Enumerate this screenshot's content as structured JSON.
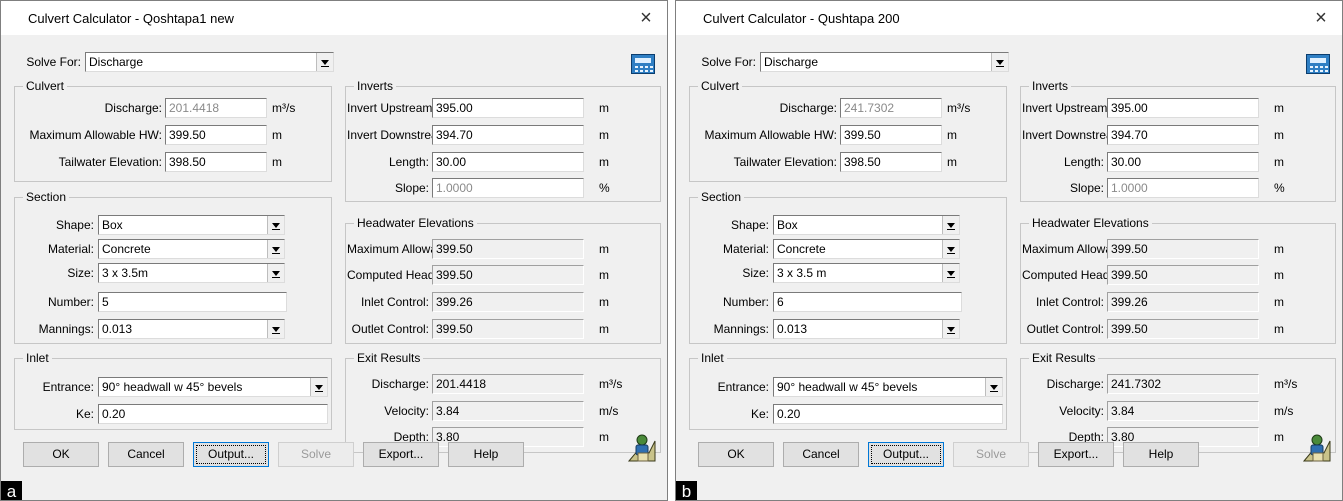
{
  "a": {
    "title": "Culvert Calculator - Qoshtapa1 new",
    "close": "×",
    "solve_for_label": "Solve For:",
    "solve_for_value": "Discharge",
    "culvert": {
      "title": "Culvert",
      "discharge_label": "Discharge:",
      "discharge_value": "201.4418",
      "discharge_unit": "m³/s",
      "max_hw_label": "Maximum Allowable HW:",
      "max_hw_value": "399.50",
      "max_hw_unit": "m",
      "tailwater_label": "Tailwater Elevation:",
      "tailwater_value": "398.50",
      "tailwater_unit": "m"
    },
    "section": {
      "title": "Section",
      "shape_label": "Shape:",
      "shape_value": "Box",
      "material_label": "Material:",
      "material_value": "Concrete",
      "size_label": "Size:",
      "size_value": "3 x 3.5m",
      "number_label": "Number:",
      "number_value": "5",
      "mannings_label": "Mannings:",
      "mannings_value": "0.013"
    },
    "inlet": {
      "title": "Inlet",
      "entrance_label": "Entrance:",
      "entrance_value": "90° headwall w 45° bevels",
      "ke_label": "Ke:",
      "ke_value": "0.20"
    },
    "inverts": {
      "title": "Inverts",
      "upstream_label": "Invert Upstream:",
      "upstream_value": "395.00",
      "upstream_unit": "m",
      "downstream_label": "Invert Downstream:",
      "downstream_value": "394.70",
      "downstream_unit": "m",
      "length_label": "Length:",
      "length_value": "30.00",
      "length_unit": "m",
      "slope_label": "Slope:",
      "slope_value": "1.0000",
      "slope_unit": "%"
    },
    "headwater": {
      "title": "Headwater Elevations",
      "max_label": "Maximum Allowable:",
      "max_value": "399.50",
      "max_unit": "m",
      "computed_label": "Computed Headwater:",
      "computed_value": "399.50",
      "computed_unit": "m",
      "inlet_label": "Inlet Control:",
      "inlet_value": "399.26",
      "inlet_unit": "m",
      "outlet_label": "Outlet Control:",
      "outlet_value": "399.50",
      "outlet_unit": "m"
    },
    "exit": {
      "title": "Exit Results",
      "discharge_label": "Discharge:",
      "discharge_value": "201.4418",
      "discharge_unit": "m³/s",
      "velocity_label": "Velocity:",
      "velocity_value": "3.84",
      "velocity_unit": "m/s",
      "depth_label": "Depth:",
      "depth_value": "3.80",
      "depth_unit": "m"
    },
    "buttons": {
      "ok": "OK",
      "cancel": "Cancel",
      "output": "Output...",
      "solve": "Solve",
      "export": "Export...",
      "help": "Help"
    },
    "corner_label": "a"
  },
  "b": {
    "title": "Culvert Calculator - Qushtapa 200",
    "close": "×",
    "solve_for_label": "Solve For:",
    "solve_for_value": "Discharge",
    "culvert": {
      "title": "Culvert",
      "discharge_label": "Discharge:",
      "discharge_value": "241.7302",
      "discharge_unit": "m³/s",
      "max_hw_label": "Maximum Allowable HW:",
      "max_hw_value": "399.50",
      "max_hw_unit": "m",
      "tailwater_label": "Tailwater Elevation:",
      "tailwater_value": "398.50",
      "tailwater_unit": "m"
    },
    "section": {
      "title": "Section",
      "shape_label": "Shape:",
      "shape_value": "Box",
      "material_label": "Material:",
      "material_value": "Concrete",
      "size_label": "Size:",
      "size_value": "3 x 3.5 m",
      "number_label": "Number:",
      "number_value": "6",
      "mannings_label": "Mannings:",
      "mannings_value": "0.013"
    },
    "inlet": {
      "title": "Inlet",
      "entrance_label": "Entrance:",
      "entrance_value": "90° headwall w 45° bevels",
      "ke_label": "Ke:",
      "ke_value": "0.20"
    },
    "inverts": {
      "title": "Inverts",
      "upstream_label": "Invert Upstream:",
      "upstream_value": "395.00",
      "upstream_unit": "m",
      "downstream_label": "Invert Downstream:",
      "downstream_value": "394.70",
      "downstream_unit": "m",
      "length_label": "Length:",
      "length_value": "30.00",
      "length_unit": "m",
      "slope_label": "Slope:",
      "slope_value": "1.0000",
      "slope_unit": "%"
    },
    "headwater": {
      "title": "Headwater Elevations",
      "max_label": "Maximum Allowable:",
      "max_value": "399.50",
      "max_unit": "m",
      "computed_label": "Computed Headwater:",
      "computed_value": "399.50",
      "computed_unit": "m",
      "inlet_label": "Inlet Control:",
      "inlet_value": "399.26",
      "inlet_unit": "m",
      "outlet_label": "Outlet Control:",
      "outlet_value": "399.50",
      "outlet_unit": "m"
    },
    "exit": {
      "title": "Exit Results",
      "discharge_label": "Discharge:",
      "discharge_value": "241.7302",
      "discharge_unit": "m³/s",
      "velocity_label": "Velocity:",
      "velocity_value": "3.84",
      "velocity_unit": "m/s",
      "depth_label": "Depth:",
      "depth_value": "3.80",
      "depth_unit": "m"
    },
    "buttons": {
      "ok": "OK",
      "cancel": "Cancel",
      "output": "Output...",
      "solve": "Solve",
      "export": "Export...",
      "help": "Help"
    },
    "corner_label": "b"
  },
  "icons": {
    "calculator": "calculator-icon",
    "technician": "technician-icon",
    "close": "close-icon"
  },
  "colors": {
    "dialog_bg": "#f0f0f0",
    "readonly_text": "#8a8a8a",
    "calc_icon": "#2f7fc4"
  }
}
